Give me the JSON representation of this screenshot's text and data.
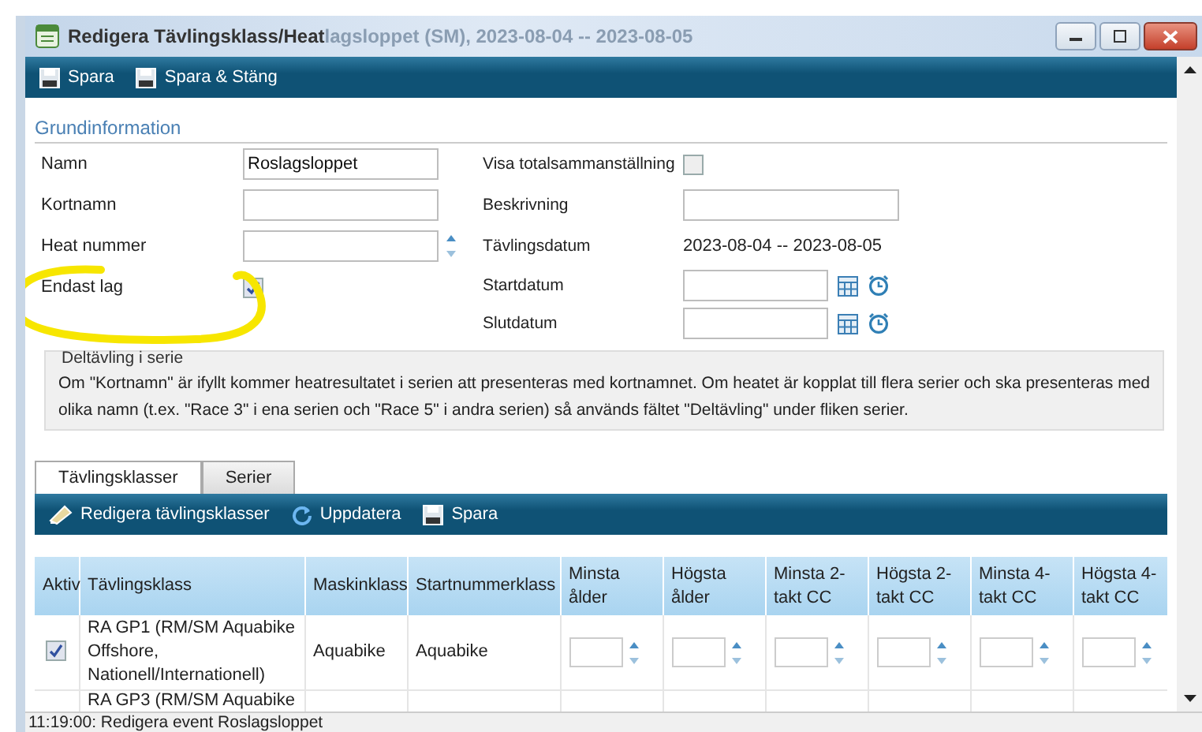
{
  "window": {
    "title": "Redigera Tävlingsklass/Heat",
    "title_overflow": "lagsloppet (SM), 2023-08-04 -- 2023-08-05"
  },
  "toolbar": [
    {
      "label": "Spara"
    },
    {
      "label": "Spara & Stäng"
    }
  ],
  "section_title": "Grundinformation",
  "left_fields": [
    {
      "kind": "text",
      "label": "Namn",
      "value": "Roslagsloppet"
    },
    {
      "kind": "text",
      "label": "Kortnamn"
    },
    {
      "kind": "spin",
      "label": "Heat nummer"
    },
    {
      "kind": "checkbox",
      "label": "Endast lag",
      "checked": true
    }
  ],
  "right_fields": [
    {
      "kind": "checkbox",
      "label": "Visa totalsammanställning",
      "checked": false
    },
    {
      "kind": "text",
      "label": "Beskrivning"
    },
    {
      "kind": "static",
      "label": "Tävlingsdatum",
      "value": "2023-08-04 -- 2023-08-05"
    },
    {
      "kind": "datetime",
      "label": "Startdatum"
    },
    {
      "kind": "datetime",
      "label": "Slutdatum"
    }
  ],
  "info_box": {
    "legend": "Deltävling i serie",
    "text": "Om \"Kortnamn\" är ifyllt kommer heatresultatet i serien att presenteras med kortnamnet. Om heatet är kopplat till flera serier och ska presenteras med olika namn (t.ex. \"Race 3\" i ena serien och \"Race 5\" i andra serien) så används fältet \"Deltävling\" under fliken serier."
  },
  "tabs": [
    {
      "label": "Tävlingsklasser",
      "selected": true
    },
    {
      "label": "Serier",
      "selected": false
    }
  ],
  "tab_toolbar": [
    {
      "kind": "edit",
      "label": "Redigera tävlingsklasser"
    },
    {
      "kind": "refresh",
      "label": "Uppdatera"
    },
    {
      "kind": "save",
      "label": "Spara"
    }
  ],
  "table": {
    "columns": [
      "Aktiv",
      "Tävlingsklass",
      "Maskinklass",
      "Startnummerklass",
      "Minsta ålder",
      "Högsta ålder",
      "Minsta 2-takt CC",
      "Högsta 2-takt CC",
      "Minsta 4-takt CC",
      "Högsta 4-takt CC"
    ],
    "rows": [
      {
        "kind": "full",
        "active": true,
        "cells": [
          "",
          "RA GP1 (RM/SM Aquabike Offshore, Nationell/Internationell)",
          "Aquabike",
          "Aquabike"
        ]
      },
      {
        "kind": "partial",
        "cells": [
          "",
          "RA GP3 (RM/SM Aquabike"
        ]
      }
    ]
  },
  "status_bar": "11:19:00: Redigera event Roslagsloppet"
}
